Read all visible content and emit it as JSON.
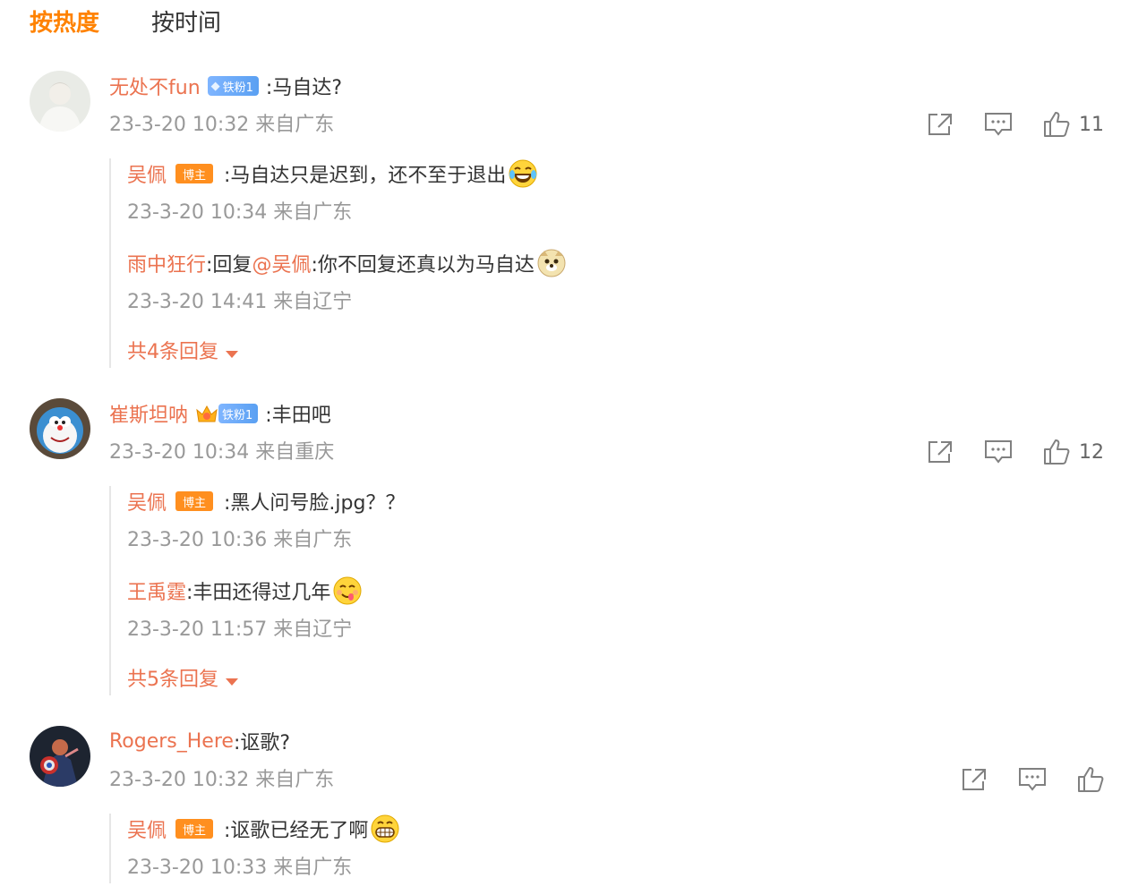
{
  "tabs": {
    "hot": "按热度",
    "time": "按时间"
  },
  "colors": {
    "accent": "#ff8200",
    "username": "#eb7350",
    "meta": "#999999",
    "text": "#333333"
  },
  "comments": [
    {
      "user": "无处不fun",
      "fan_badge": "铁粉1",
      "text": ":马自达?",
      "meta": "23-3-20 10:32 来自广东",
      "likes": "11",
      "replies": [
        {
          "user": "吴佩",
          "blogger_badge": "博主",
          "text": ":马自达只是迟到，还不至于退出",
          "emoji": "laugh-cry-emoji",
          "meta": "23-3-20 10:34 来自广东"
        },
        {
          "user": "雨中狂行",
          "text_pre": ":回复",
          "mention": "@吴佩",
          "text": ":你不回复还真以为马自达",
          "emoji": "doge-emoji",
          "meta": "23-3-20 14:41 来自辽宁"
        }
      ],
      "more": "共4条回复"
    },
    {
      "user": "崔斯坦呐",
      "fan_badge": "铁粉1",
      "text": ":丰田吧",
      "meta": "23-3-20 10:34 来自重庆",
      "likes": "12",
      "replies": [
        {
          "user": "吴佩",
          "blogger_badge": "博主",
          "text": ":黑人问号脸.jpg？？",
          "meta": "23-3-20 10:36 来自广东"
        },
        {
          "user": "王禹霆",
          "text": ":丰田还得过几年",
          "emoji": "yummy-emoji",
          "meta": "23-3-20 11:57 来自辽宁"
        }
      ],
      "more": "共5条回复"
    },
    {
      "user": "Rogers_Here",
      "text": ":讴歌?",
      "meta": "23-3-20 10:32 来自广东",
      "likes": "",
      "replies": [
        {
          "user": "吴佩",
          "blogger_badge": "博主",
          "text": ":讴歌已经无了啊",
          "emoji": "grin-emoji",
          "meta": "23-3-20 10:33 来自广东"
        }
      ]
    }
  ]
}
